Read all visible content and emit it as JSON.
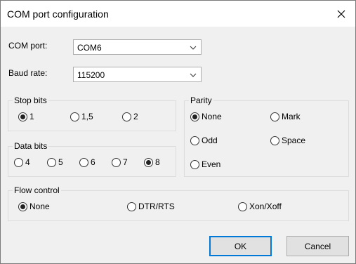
{
  "window": {
    "title": "COM port configuration"
  },
  "com_port": {
    "label": "COM port:",
    "value": "COM6"
  },
  "baud_rate": {
    "label": "Baud rate:",
    "value": "115200"
  },
  "stop_bits": {
    "title": "Stop bits",
    "options": [
      "1",
      "1,5",
      "2"
    ],
    "selected": "1"
  },
  "data_bits": {
    "title": "Data bits",
    "options": [
      "4",
      "5",
      "6",
      "7",
      "8"
    ],
    "selected": "8"
  },
  "parity": {
    "title": "Parity",
    "options": [
      "None",
      "Mark",
      "Odd",
      "Space",
      "Even"
    ],
    "selected": "None"
  },
  "flow_control": {
    "title": "Flow control",
    "options": [
      "None",
      "DTR/RTS",
      "Xon/Xoff"
    ],
    "selected": "None"
  },
  "buttons": {
    "ok": "OK",
    "cancel": "Cancel"
  },
  "colors": {
    "accent": "#0078d7",
    "background": "#f0f0f0"
  }
}
